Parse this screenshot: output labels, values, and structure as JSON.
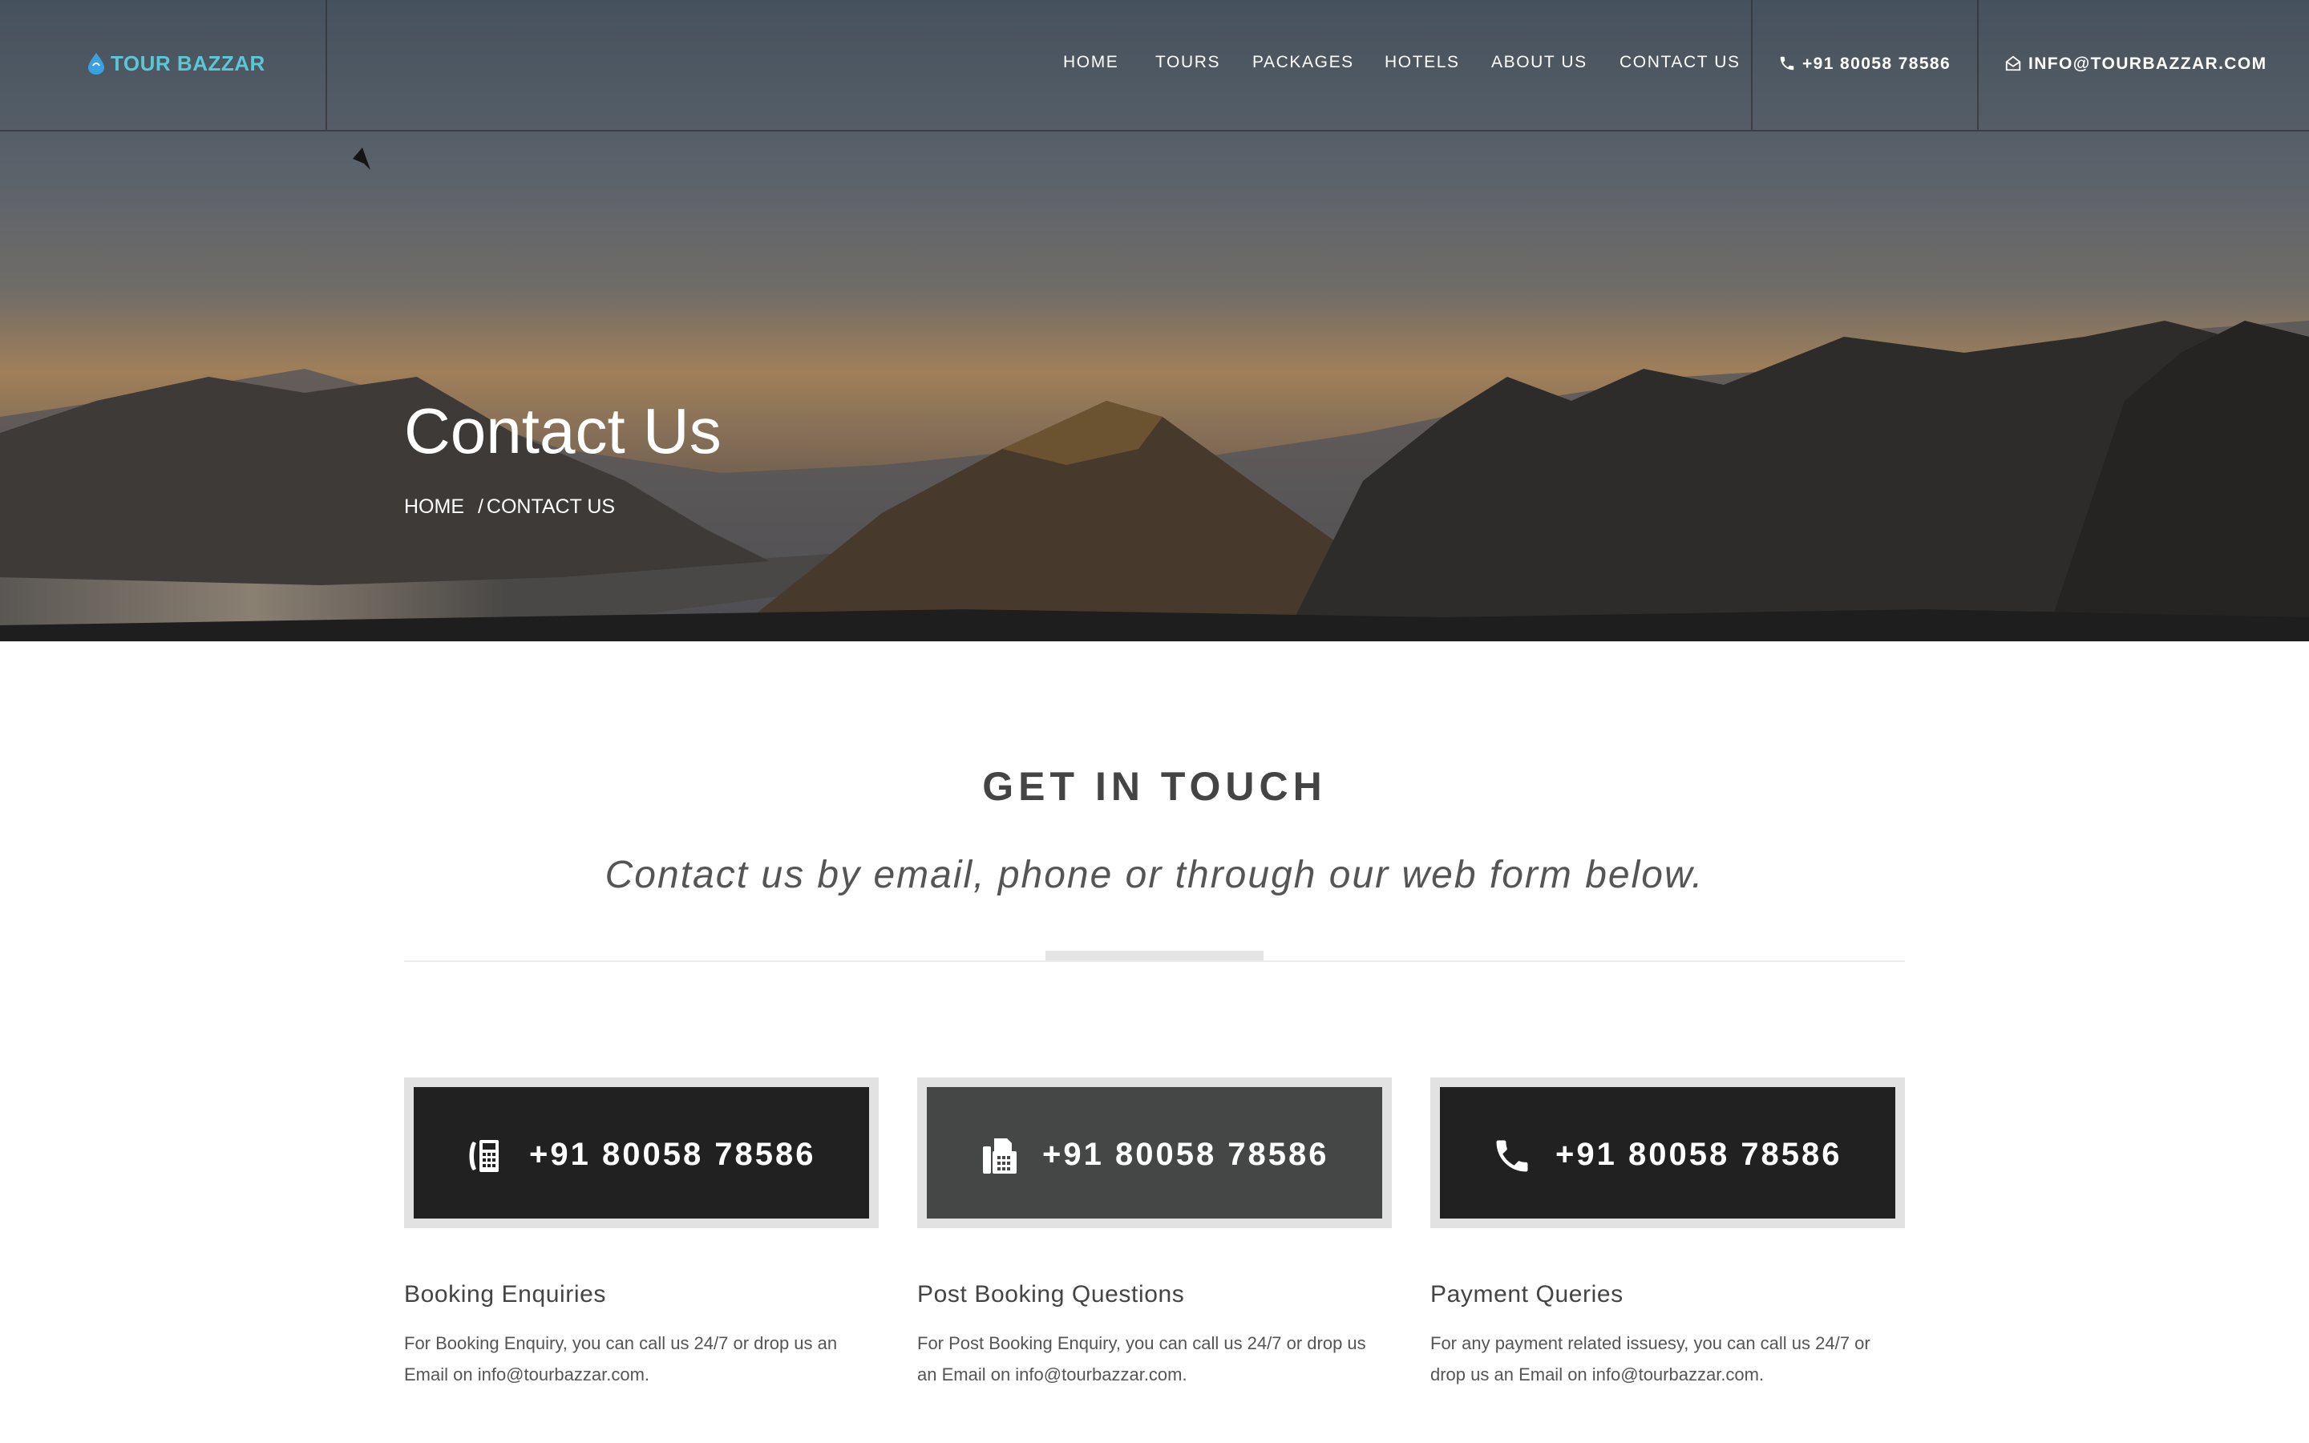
{
  "header": {
    "logo_text": "TOUR BAZZAR",
    "nav": [
      {
        "label": "HOME"
      },
      {
        "label": "TOURS"
      },
      {
        "label": "PACKAGES"
      },
      {
        "label": "HOTELS"
      },
      {
        "label": "ABOUT US"
      },
      {
        "label": "CONTACT US"
      }
    ],
    "phone": "+91 80058 78586",
    "email": "INFO@TOURBAZZAR.COM"
  },
  "hero": {
    "title": "Contact Us",
    "breadcrumb": {
      "home": "HOME",
      "separator": "/",
      "current": "CONTACT US"
    }
  },
  "main": {
    "title": "GET IN TOUCH",
    "subtitle": "Contact us by email, phone or through our web form below.",
    "cards": [
      {
        "icon": "landline-phone-icon",
        "phone": "+91 80058 78586"
      },
      {
        "icon": "fax-icon",
        "phone": "+91 80058 78586"
      },
      {
        "icon": "phone-handset-icon",
        "phone": "+91 80058 78586"
      }
    ],
    "columns": [
      {
        "title": "Booking Enquiries",
        "text": "For Booking Enquiry, you can call us 24/7 or drop us an Email on info@tourbazzar.com."
      },
      {
        "title": "Post Booking Questions",
        "text": "For Post Booking Enquiry, you can call us 24/7 or drop us an Email on info@tourbazzar.com."
      },
      {
        "title": "Payment Queries",
        "text": "For any payment related issuesy, you can call us 24/7 or drop us an Email on info@tourbazzar.com."
      }
    ]
  },
  "colors": {
    "logo": "#5cc7d4",
    "card_dark": "#212121",
    "card_grey": "#454747",
    "card_border": "#e2e2e2"
  }
}
